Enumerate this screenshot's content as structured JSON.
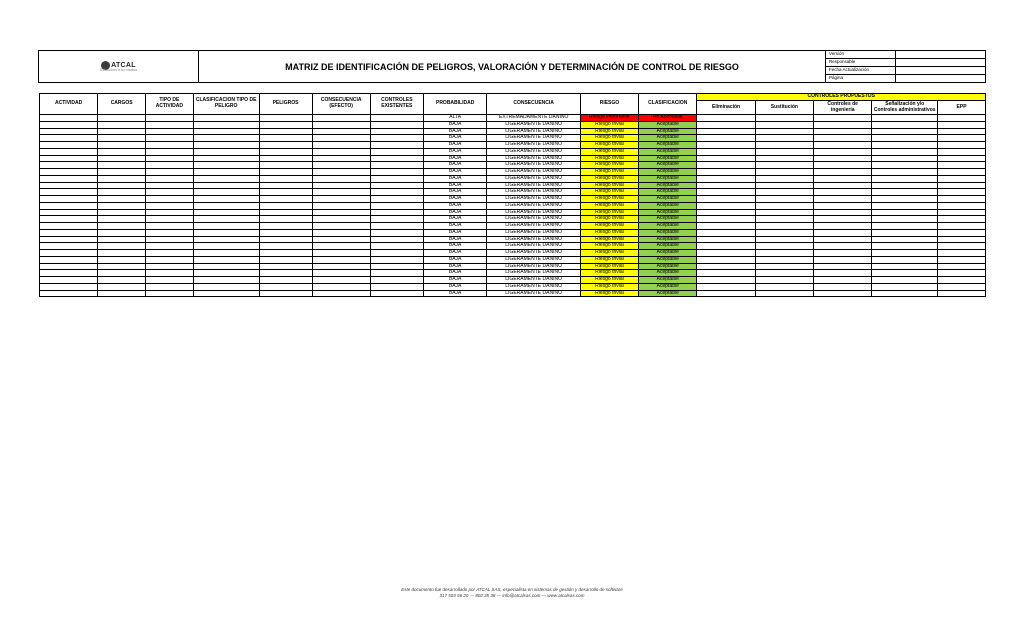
{
  "header": {
    "logo_text": "ATCAL",
    "logo_sub": "Soluciones a su medida",
    "title": "MATRIZ DE IDENTIFICACIÓN DE PELIGROS,  VALORACIÓN Y DETERMINACIÓN DE  CONTROL DE RIESGO",
    "meta": [
      {
        "label": "Versión",
        "value": ""
      },
      {
        "label": "Responsable",
        "value": ""
      },
      {
        "label": "Fecha Actualización",
        "value": ""
      },
      {
        "label": "Página",
        "value": ""
      }
    ]
  },
  "columns": {
    "main": [
      "ACTIVIDAD",
      "CARGOS",
      "TIPO DE ACTIVIDAD",
      "CLASIFICACION TIPO DE PELIGRO",
      "PELIGROS",
      "CONSECUENCIA (EFECTO)",
      "CONTROLES EXISTENTES",
      "PROBABILIDAD",
      "CONSECUENCIA",
      "RIESGO",
      "CLASIFICACION"
    ],
    "controles_group": "CONTROLES PROPUESTOS",
    "controles_sub": [
      "Eliminación",
      "Sustitución",
      "Controles de ingeniería",
      "Señalización y/o Controles administrativos",
      "EPP"
    ]
  },
  "special_row": {
    "probabilidad": "ALTA",
    "consecuencia": "EXTREMADAMENTE DAÑINO",
    "riesgo": "Riesgo importante",
    "clasificacion": "No Aceptable"
  },
  "row_template": {
    "probabilidad": "BAJA",
    "consecuencia": "LIGERAMENTE DAÑINO",
    "riesgo": "Riesgo trivial",
    "clasificacion": "Aceptable"
  },
  "row_count_baja": 26,
  "footer": {
    "line1": "Este documento fue desarrollado por ATCAL SAS, especialista en sistemas de gestión y desarrollo de software",
    "line2": "317 503 56 20 — 802 35 38 — info@atcalsas.com — www.atcalsas.com"
  }
}
